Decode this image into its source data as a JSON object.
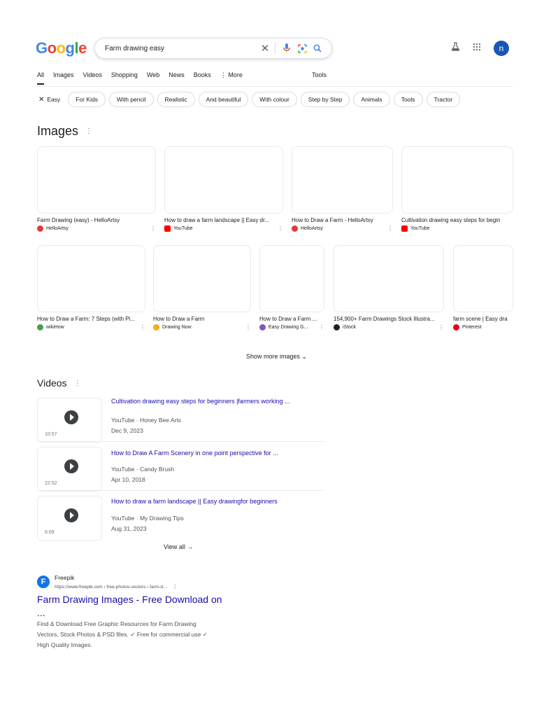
{
  "logo": {
    "g1": "G",
    "o1": "o",
    "o2": "o",
    "g2": "g",
    "l": "l",
    "e": "e"
  },
  "search": {
    "value": "Farm drawing easy"
  },
  "header": {
    "avatar_letter": "n"
  },
  "tabs": [
    "All",
    "Images",
    "Videos",
    "Shopping",
    "Web",
    "News",
    "Books",
    "⋮ More"
  ],
  "tools_label": "Tools",
  "chips": [
    "Easy",
    "For Kids",
    "With pencil",
    "Realistic",
    "And beautiful",
    "With colour",
    "Step by Step",
    "Animals",
    "Tools",
    "Tractor"
  ],
  "images": {
    "title": "Images",
    "row1": [
      {
        "caption": "Farm Drawing (easy) - HelloArtsy",
        "source": "HelloArtsy",
        "color": "#e53935"
      },
      {
        "caption": "How to draw a farm landscape || Easy dr...",
        "source": "YouTube",
        "color": "#ff0000"
      },
      {
        "caption": "How to Draw a Farm - HelloArtsy",
        "source": "HelloArtsy",
        "color": "#e53935"
      },
      {
        "caption": "Cultivation drawing easy steps for begin",
        "source": "YouTube",
        "color": "#ff0000"
      }
    ],
    "row2": [
      {
        "caption": "How to Draw a Farm: 7 Steps (with Pi...",
        "source": "wikiHow",
        "color": "#43a047"
      },
      {
        "caption": "How to Draw a Farm",
        "source": "Drawing Now",
        "color": "#f9a825"
      },
      {
        "caption": "How to Draw a Farm ...",
        "source": "Easy Drawing G...",
        "color": "#7e57c2"
      },
      {
        "caption": "154,900+ Farm Drawings Stock Illustra...",
        "source": "iStock",
        "color": "#202124"
      },
      {
        "caption": "farm scene | Easy dra",
        "source": "Pinterest",
        "color": "#e60023"
      }
    ],
    "show_more": "Show more images ⌄"
  },
  "videos": {
    "title": "Videos",
    "items": [
      {
        "title": "Cultivation drawing easy steps for beginners |farmers working ...",
        "source": "YouTube · Honey Bee Arts",
        "date": "Dec 9, 2023",
        "duration": "10:57"
      },
      {
        "title": "How to Draw A Farm Scenery in one point perspective for ...",
        "source": "YouTube · Candy Brush",
        "date": "Apr 10, 2018",
        "duration": "22:52"
      },
      {
        "title": "How to draw a farm landscape || Easy drawingfor beginners",
        "source": "YouTube · My Drawing Tips",
        "date": "Aug 31, 2023",
        "duration": "6:09"
      }
    ],
    "view_all": "View all →"
  },
  "result": {
    "site": "Freepik",
    "url": "https://www.freepik.com › free-photos-vectors › farm-d...",
    "url_more": "⋮",
    "title": "Farm Drawing Images - Free Download on ...",
    "desc": "Find & Download Free Graphic Resources for Farm Drawing Vectors, Stock Photos & PSD files. ✓ Free for commercial use ✓ High Quality Images.",
    "favicon_letter": "F"
  }
}
